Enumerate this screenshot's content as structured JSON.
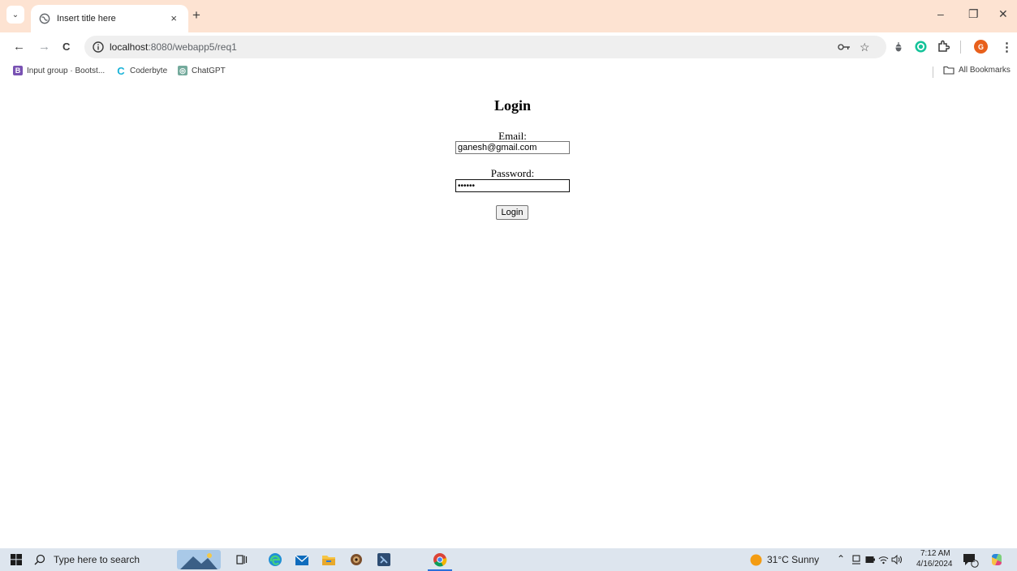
{
  "browser": {
    "tab": {
      "title": "Insert title here",
      "close": "×"
    },
    "new_tab": "+",
    "window_controls": {
      "minimize": "–",
      "restore": "❐",
      "close": "✕"
    },
    "nav": {
      "back": "←",
      "forward": "→",
      "reload": "C"
    },
    "address": {
      "host": "localhost",
      "path": ":8080/webapp5/req1"
    },
    "profile_initial": "G",
    "menu": "⋮"
  },
  "bookmarks": {
    "items": [
      {
        "label": "Input group · Bootst...",
        "icon": "bootstrap-icon",
        "glyph": "B",
        "color": "#7952b3"
      },
      {
        "label": "Coderbyte",
        "icon": "coderbyte-icon",
        "glyph": "C",
        "color": "#1ab3d8"
      },
      {
        "label": "ChatGPT",
        "icon": "chatgpt-icon",
        "glyph": "◎",
        "color": "#74aa9c"
      }
    ],
    "all_bookmarks": "All Bookmarks"
  },
  "page": {
    "title": "Login",
    "email_label": "Email:",
    "email_value": "ganesh@gmail.com",
    "password_label": "Password:",
    "password_value": "••••••",
    "submit_label": "Login"
  },
  "taskbar": {
    "search_placeholder": "Type here to search",
    "weather": "31°C  Sunny",
    "time": "7:12 AM",
    "date": "4/16/2024",
    "notification_count": "2"
  }
}
